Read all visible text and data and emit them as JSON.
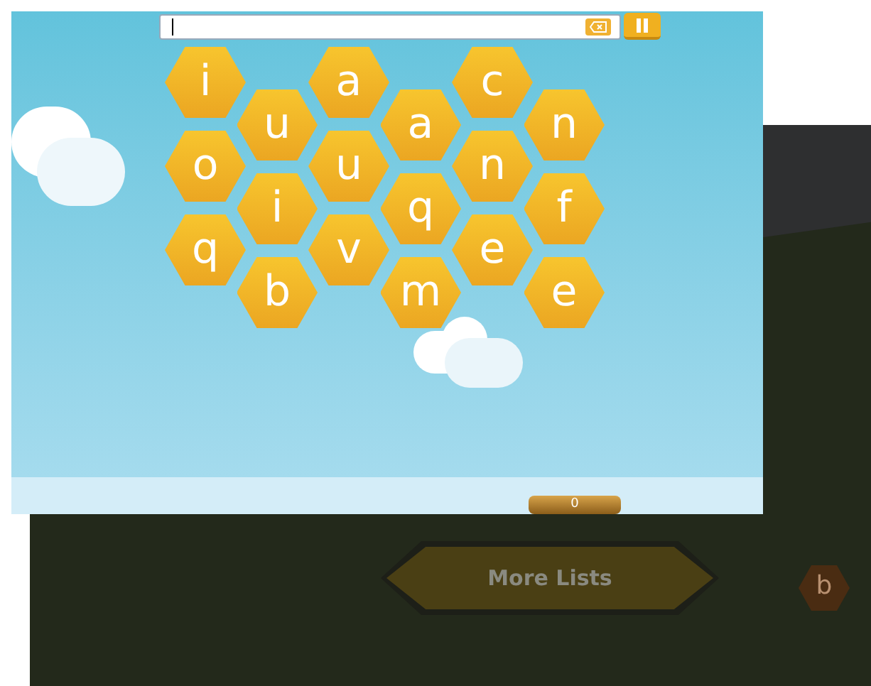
{
  "board": {
    "columns": [
      {
        "tiles": [
          "i",
          "o",
          "q"
        ]
      },
      {
        "tiles": [
          "u",
          "i",
          "b"
        ]
      },
      {
        "tiles": [
          "a",
          "u",
          "v"
        ]
      },
      {
        "tiles": [
          "a",
          "q",
          "m"
        ]
      },
      {
        "tiles": [
          "c",
          "n",
          "e"
        ]
      },
      {
        "tiles": [
          "n",
          "f",
          "e"
        ]
      }
    ]
  },
  "score": "0",
  "background": {
    "button": "More Lists",
    "tiles": [
      "b"
    ]
  }
}
